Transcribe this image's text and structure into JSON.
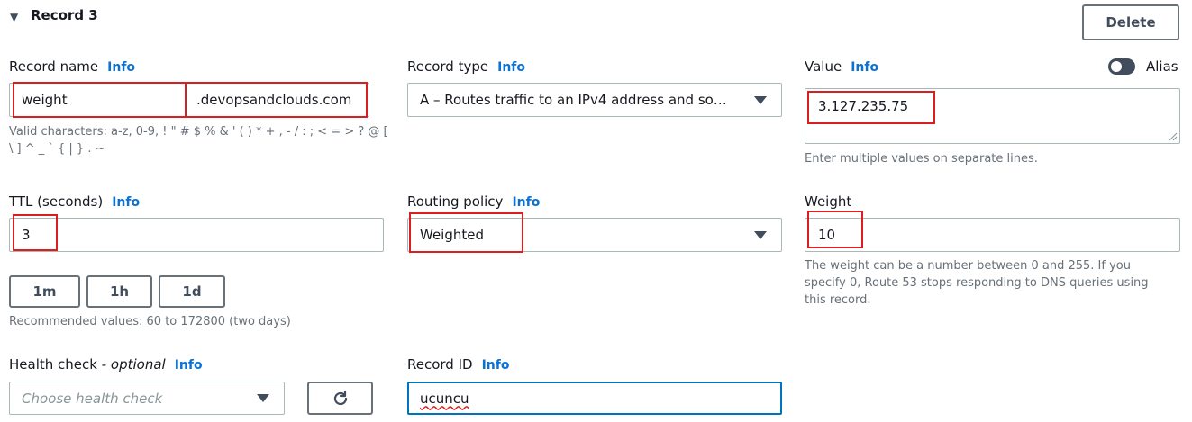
{
  "record": {
    "title": "Record 3",
    "delete_label": "Delete"
  },
  "info_label": "Info",
  "record_name": {
    "label": "Record name",
    "value": "weight",
    "domain_suffix": ".devopsandclouds.com",
    "hint_line1": "Valid characters: a-z, 0-9, ! \" # $ % & ' ( ) * + , - / : ; < = > ? @ [",
    "hint_line2": "\\ ] ^ _ ` { | } . ~"
  },
  "record_type": {
    "label": "Record type",
    "value": "A – Routes traffic to an IPv4 address and so…"
  },
  "value_field": {
    "label": "Value",
    "alias_label": "Alias",
    "value": "3.127.235.75",
    "hint": "Enter multiple values on separate lines."
  },
  "ttl": {
    "label": "TTL (seconds)",
    "value": "3",
    "buttons": [
      "1m",
      "1h",
      "1d"
    ],
    "hint": "Recommended values: 60 to 172800 (two days)"
  },
  "routing_policy": {
    "label": "Routing policy",
    "value": "Weighted"
  },
  "weight": {
    "label": "Weight",
    "value": "10",
    "hint_line1": "The weight can be a number between 0 and 255. If you",
    "hint_line2": "specify 0, Route 53 stops responding to DNS queries using",
    "hint_line3": "this record."
  },
  "health_check": {
    "label": "Health check - ",
    "label_optional": "optional",
    "placeholder": "Choose health check"
  },
  "record_id": {
    "label": "Record ID",
    "value": "ucuncu"
  },
  "colors": {
    "accent": "#0972d3",
    "highlight": "#d91f1f",
    "focus": "#0073bb"
  },
  "icons": [
    "caret-down-icon",
    "dropdown-caret-icon",
    "refresh-icon",
    "toggle-switch"
  ]
}
